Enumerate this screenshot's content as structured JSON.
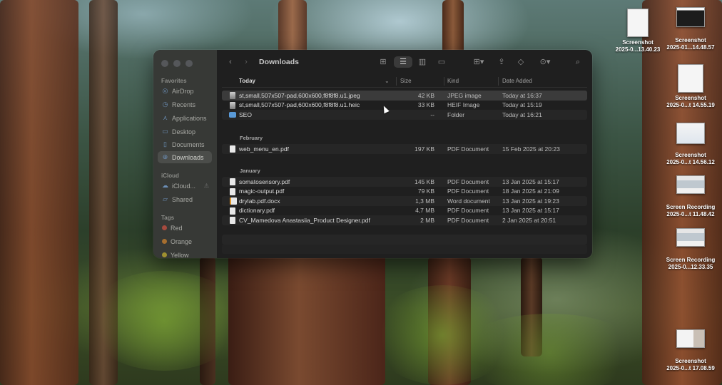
{
  "window": {
    "title": "Downloads",
    "toolbar": {
      "back_icon": "chevron-left",
      "forward_icon": "chevron-right",
      "view_icons": [
        "grid-view",
        "list-view",
        "column-view",
        "gallery-view"
      ],
      "group_icon": "group-by",
      "share_icon": "share",
      "tag_icon": "tag",
      "more_icon": "ellipsis-circle",
      "search_icon": "magnifier"
    }
  },
  "sidebar": {
    "favorites_label": "Favorites",
    "favorites": [
      {
        "label": "AirDrop",
        "icon": "airdrop"
      },
      {
        "label": "Recents",
        "icon": "clock"
      },
      {
        "label": "Applications",
        "icon": "apps"
      },
      {
        "label": "Desktop",
        "icon": "desktop"
      },
      {
        "label": "Documents",
        "icon": "document"
      },
      {
        "label": "Downloads",
        "icon": "download"
      }
    ],
    "icloud_label": "iCloud",
    "icloud": [
      {
        "label": "iCloud...",
        "icon": "cloud"
      },
      {
        "label": "Shared",
        "icon": "shared-folder"
      }
    ],
    "tags_label": "Tags",
    "tags": [
      {
        "label": "Red",
        "color": "#e5534b"
      },
      {
        "label": "Orange",
        "color": "#e39036"
      },
      {
        "label": "Yellow",
        "color": "#d8c53b"
      }
    ]
  },
  "columns": {
    "name": "Today",
    "size": "Size",
    "kind": "Kind",
    "date": "Date Added"
  },
  "groups": [
    {
      "label": "Today",
      "files": [
        {
          "name": "st,small,507x507-pad,600x600,f8f8f8.u1.jpeg",
          "size": "42 KB",
          "kind": "JPEG image",
          "date": "Today at 16:37",
          "icon": "image"
        },
        {
          "name": "st,small,507x507-pad,600x600,f8f8f8.u1.heic",
          "size": "33 KB",
          "kind": "HEIF Image",
          "date": "Today at 15:19",
          "icon": "image"
        },
        {
          "name": "SEO",
          "size": "--",
          "kind": "Folder",
          "date": "Today at 16:21",
          "icon": "folder"
        }
      ]
    },
    {
      "label": "February",
      "files": [
        {
          "name": "web_menu_en.pdf",
          "size": "197 KB",
          "kind": "PDF Document",
          "date": "15 Feb 2025 at 20:23",
          "icon": "pdf"
        }
      ]
    },
    {
      "label": "January",
      "files": [
        {
          "name": "somatosensory.pdf",
          "size": "145 KB",
          "kind": "PDF Document",
          "date": "13 Jan 2025 at 15:17",
          "icon": "pdf"
        },
        {
          "name": "magic-output.pdf",
          "size": "79 KB",
          "kind": "PDF Document",
          "date": "18 Jan 2025 at 21:09",
          "icon": "pdf"
        },
        {
          "name": "drylab.pdf.docx",
          "size": "1,3 MB",
          "kind": "Word document",
          "date": "13 Jan 2025 at 19:23",
          "icon": "docx"
        },
        {
          "name": "dictionary.pdf",
          "size": "4,7 MB",
          "kind": "PDF Document",
          "date": "13 Jan 2025 at 15:17",
          "icon": "pdf"
        },
        {
          "name": "CV_Mamedova Anastasiia_Product Designer.pdf",
          "size": "2 MB",
          "kind": "PDF Document",
          "date": "2 Jan 2025 at 20:51",
          "icon": "pdf"
        }
      ]
    }
  ],
  "desktop_icons": [
    {
      "line1": "Screenshot",
      "line2": "2025-0...13.40.23"
    },
    {
      "line1": "Screenshot",
      "line2": "2025-01...14.48.57"
    },
    {
      "line1": "Screenshot",
      "line2": "2025-0...t 14.55.19"
    },
    {
      "line1": "Screenshot",
      "line2": "2025-0...t 14.56.12"
    },
    {
      "line1": "Screen Recording",
      "line2": "2025-0...t 11.48.42"
    },
    {
      "line1": "Screen Recording",
      "line2": "2025-0...12.33.35"
    },
    {
      "line1": "Screenshot",
      "line2": "2025-0...t 17.08.59"
    }
  ]
}
